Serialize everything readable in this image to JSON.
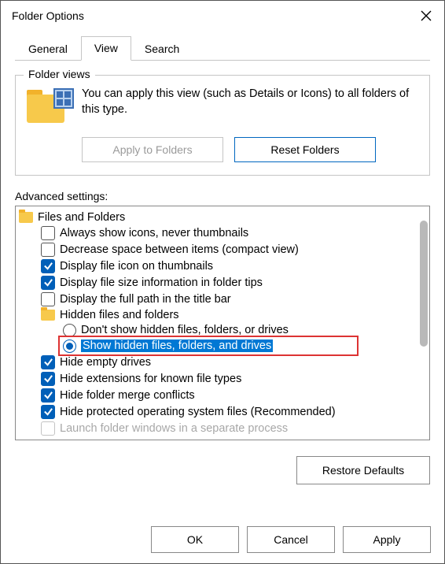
{
  "window": {
    "title": "Folder Options"
  },
  "tabs": {
    "general": "General",
    "view": "View",
    "search": "Search"
  },
  "folder_views": {
    "legend": "Folder views",
    "text": "You can apply this view (such as Details or Icons) to all folders of this type.",
    "apply": "Apply to Folders",
    "reset": "Reset Folders"
  },
  "advanced_label": "Advanced settings:",
  "tree": {
    "root": "Files and Folders",
    "items": [
      {
        "label": "Always show icons, never thumbnails",
        "checked": false
      },
      {
        "label": "Decrease space between items (compact view)",
        "checked": false
      },
      {
        "label": "Display file icon on thumbnails",
        "checked": true
      },
      {
        "label": "Display file size information in folder tips",
        "checked": true
      },
      {
        "label": "Display the full path in the title bar",
        "checked": false
      }
    ],
    "hidden_group": "Hidden files and folders",
    "radio": {
      "dont": "Don't show hidden files, folders, or drives",
      "show": "Show hidden files, folders, and drives"
    },
    "after": [
      {
        "label": "Hide empty drives",
        "checked": true
      },
      {
        "label": "Hide extensions for known file types",
        "checked": true
      },
      {
        "label": "Hide folder merge conflicts",
        "checked": true
      },
      {
        "label": "Hide protected operating system files (Recommended)",
        "checked": true
      },
      {
        "label": "Launch folder windows in a separate process",
        "checked": false
      }
    ]
  },
  "restore": "Restore Defaults",
  "buttons": {
    "ok": "OK",
    "cancel": "Cancel",
    "apply": "Apply"
  }
}
